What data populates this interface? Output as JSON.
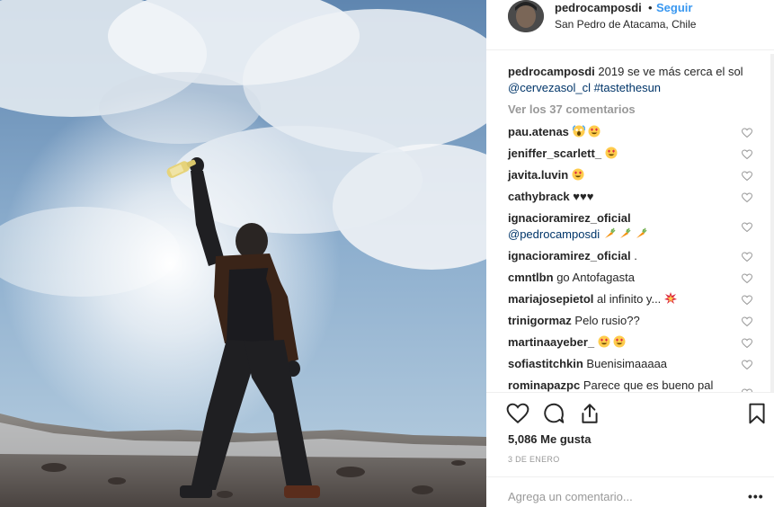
{
  "post": {
    "username": "pedrocamposdi",
    "separator": "•",
    "follow_label": "Seguir",
    "location": "San Pedro de Atacama, Chile"
  },
  "caption": {
    "username": "pedrocamposdi",
    "text": "2019 se ve más cerca el sol",
    "mention": "@cervezasol_cl",
    "hashtag": "#tastethesun"
  },
  "view_all_comments": "Ver los 37 comentarios",
  "comments": [
    {
      "user": "pau.atenas",
      "text": "",
      "emojis": [
        "scream",
        "heart-eyes"
      ]
    },
    {
      "user": "jeniffer_scarlett_",
      "text": "",
      "emojis": [
        "heart-eyes"
      ]
    },
    {
      "user": "javita.luvin",
      "text": "",
      "emojis": [
        "heart-eyes"
      ]
    },
    {
      "user": "cathybrack",
      "text": "♥♥♥",
      "emojis": []
    },
    {
      "user": "ignacioramirez_oficial",
      "text": "",
      "mention": "@pedrocamposdi",
      "emojis": [
        "carrot",
        "carrot",
        "carrot"
      ]
    },
    {
      "user": "ignacioramirez_oficial",
      "text": ".",
      "emojis": []
    },
    {
      "user": "cmntlbn",
      "text": "go Antofagasta",
      "emojis": []
    },
    {
      "user": "mariajosepietol",
      "text": "al infinito y...",
      "emojis": [
        "collision"
      ]
    },
    {
      "user": "trinigormaz",
      "text": "Pelo rusio??",
      "emojis": []
    },
    {
      "user": "martinaayeber_",
      "text": "",
      "emojis": [
        "heart-eyes",
        "heart-eyes"
      ]
    },
    {
      "user": "sofiastitchkin",
      "text": "Buenisimaaaaa",
      "emojis": []
    },
    {
      "user": "rominapazpc",
      "text": "Parece que es bueno pal",
      "emojis": []
    }
  ],
  "likes": "5,086 Me gusta",
  "date": "3 DE ENERO",
  "add_comment_placeholder": "Agrega un comentario...",
  "more_label": "•••",
  "icons": [
    "heart-icon",
    "comment-icon",
    "share-icon",
    "bookmark-icon",
    "comment-heart-icon"
  ],
  "colors": {
    "link": "#003569",
    "follow": "#3897f0",
    "muted": "#999999",
    "text": "#262626"
  }
}
